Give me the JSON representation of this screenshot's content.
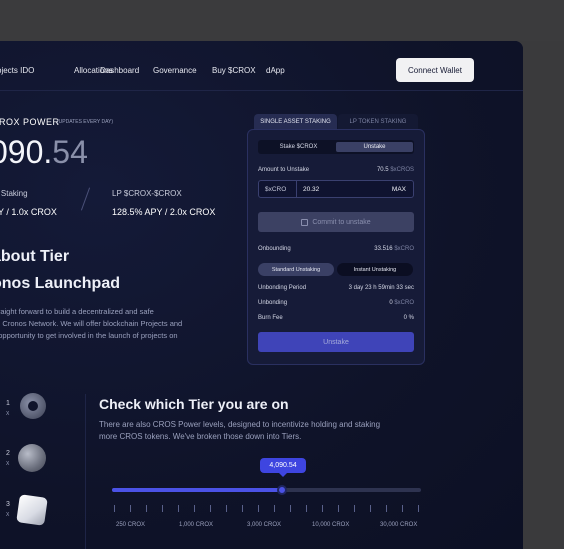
{
  "nav": {
    "items": [
      "ojects IDO",
      "Allocations",
      "Dashboard",
      "Governance",
      "Buy $CROX",
      "dApp"
    ],
    "connect_label": "Connect Wallet"
  },
  "power": {
    "title": "CROX POWER",
    "subtitle": "(UPDATES EVERY DAY)",
    "value_main": "090.",
    "value_dec": "54"
  },
  "staking": {
    "label_left": "et Staking",
    "value_left": "PY / 1.0x CROX",
    "label_right": "LP $CROX-$CROX",
    "value_right": "128.5% APY / 2.0x CROX"
  },
  "about": {
    "line1": "about Tier",
    "line2": "onos Launchpad",
    "para": [
      "straight forward to build a decentralized and safe",
      "on Cronos Network. We will offer blockchain Projects and",
      "n opportunity to get involved in the launch of projects on",
      "m."
    ]
  },
  "card": {
    "tab_active": "SINGLE ASSET STAKING",
    "tab_inactive": "LP TOKEN STAKING",
    "seg_left": "Stake $CROX",
    "seg_right": "Unstake",
    "amount_label": "Amount to Unstake",
    "amount_value": "70.5",
    "amount_unit": "$xCROS",
    "input_prefix": "$xCRO",
    "input_value": "20.32",
    "max_label": "MAX",
    "commit_label": "Commit to unstake",
    "onbounding_label": "Onbounding",
    "onbounding_value": "33.516",
    "onbounding_unit": "$xCRO",
    "pill_standard": "Standard Unstaking",
    "pill_instant": "Instant Unstaking",
    "period_label": "Unbonding Period",
    "period_value": "3 day 23 h 59min 33 sec",
    "unbonding_label": "Unbonding",
    "unbonding_value": "0",
    "unbonding_unit": "$xCRO",
    "burn_label": "Burn Fee",
    "burn_value": "0 %",
    "unstake_label": "Unstake"
  },
  "tier": {
    "heading": "Check which Tier you are on",
    "desc1": "There are also CROS Power levels, designed to incentivize holding and staking",
    "desc2": "more CROS tokens. We've broken those down into Tiers.",
    "tooltip": "4,090.54",
    "progress": 0.55,
    "ticks": [
      "250 CROX",
      "1,000 CROX",
      "3,000 CROX",
      "10,000 CROX",
      "30,000 CROX"
    ],
    "side_nums": [
      "1",
      "2",
      "3"
    ],
    "side_letters": [
      "X",
      "X",
      "X"
    ]
  },
  "colors": {
    "background": "#10142b",
    "accent": "#4b52e6",
    "card": "#161b38"
  }
}
